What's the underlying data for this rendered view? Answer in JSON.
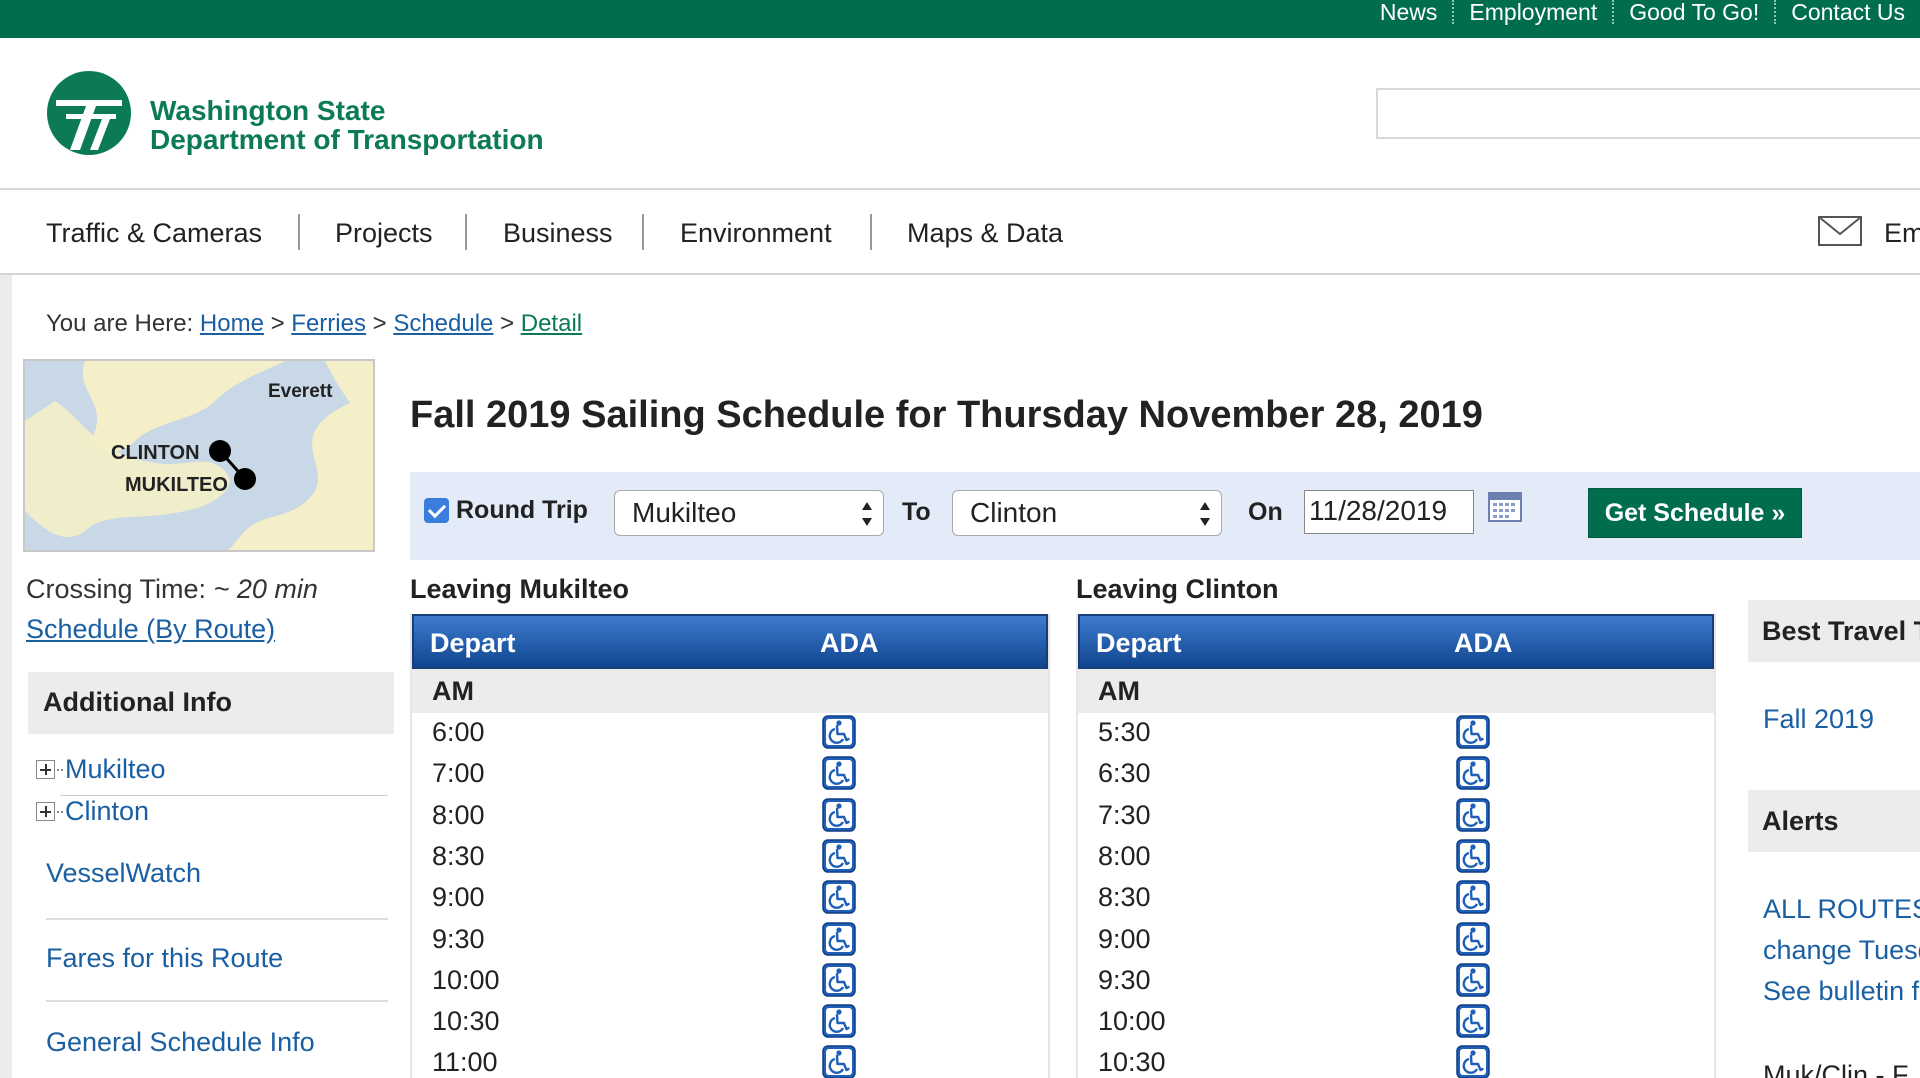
{
  "top_links": [
    "News",
    "Employment",
    "Good To Go!",
    "Contact Us"
  ],
  "header": {
    "org_line1": "Washington State",
    "org_line2": "Department of Transportation",
    "search_value": ""
  },
  "nav": {
    "items": [
      "Traffic & Cameras",
      "Projects",
      "Business",
      "Environment",
      "Maps & Data"
    ],
    "email_partial": "Em"
  },
  "breadcrumb": {
    "prefix": "You are Here:",
    "items": [
      "Home",
      "Ferries",
      "Schedule",
      "Detail"
    ],
    "separator": ">"
  },
  "map": {
    "labels": [
      "Everett",
      "CLINTON",
      "MUKILTEO"
    ]
  },
  "sidebar": {
    "crossing_label": "Crossing Time:",
    "crossing_value": "~ 20 min",
    "schedule_link": "Schedule (By Route)",
    "additional_info": "Additional Info",
    "tree": [
      "Mukilteo",
      "Clinton"
    ],
    "links": [
      "VesselWatch",
      "Fares for this Route",
      "General Schedule Info"
    ]
  },
  "main": {
    "title": "Fall 2019 Sailing Schedule for Thursday November 28, 2019",
    "form": {
      "round_trip_label": "Round Trip",
      "round_trip_checked": true,
      "from_value": "Mukilteo",
      "to_label": "To",
      "to_value": "Clinton",
      "on_label": "On",
      "date_value": "11/28/2019",
      "submit_label": "Get Schedule »"
    },
    "tables": [
      {
        "title": "Leaving Mukilteo",
        "col_depart": "Depart",
        "col_ada": "ADA",
        "period": "AM",
        "times": [
          "6:00",
          "7:00",
          "8:00",
          "8:30",
          "9:00",
          "9:30",
          "10:00",
          "10:30",
          "11:00"
        ]
      },
      {
        "title": "Leaving Clinton",
        "col_depart": "Depart",
        "col_ada": "ADA",
        "period": "AM",
        "times": [
          "5:30",
          "6:30",
          "7:30",
          "8:00",
          "8:30",
          "9:00",
          "9:30",
          "10:00",
          "10:30"
        ]
      }
    ]
  },
  "right": {
    "best_travel_header": "Best Travel T",
    "best_travel_link": "Fall 2019",
    "alerts_header": "Alerts",
    "alert_lines": [
      "ALL ROUTES",
      "change Tuesd",
      "See bulletin f"
    ],
    "bottom_partial": "Muk/Clin - F"
  },
  "colors": {
    "brand_green": "#006e4e",
    "link_blue": "#1b5fa3",
    "table_header_blue": "#1a56a8",
    "form_bg": "#e3ebf8"
  },
  "icons": [
    "wsdot-logo-icon",
    "mail-icon",
    "calendar-icon",
    "wheelchair-accessible-icon",
    "tree-expand-icon",
    "checkbox-checked-icon",
    "select-arrows-icon"
  ]
}
